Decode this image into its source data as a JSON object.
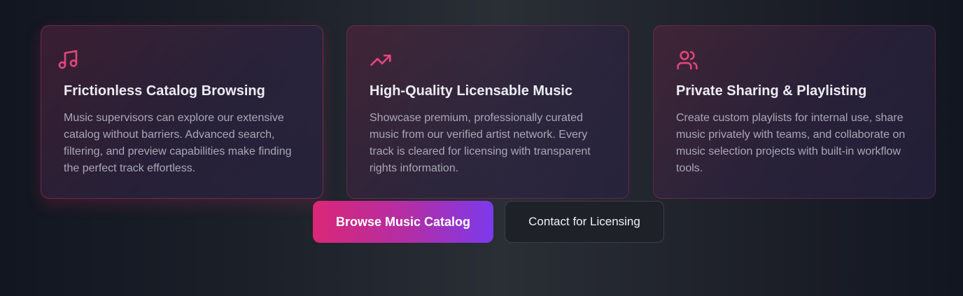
{
  "features": [
    {
      "icon": "music-note-icon",
      "title": "Frictionless Catalog Browsing",
      "description": "Music supervisors can explore our extensive catalog without barriers. Advanced search, filtering, and preview capabilities make finding the perfect track effortless."
    },
    {
      "icon": "trending-up-icon",
      "title": "High-Quality Licensable Music",
      "description": "Showcase premium, professionally curated music from our verified artist network. Every track is cleared for licensing with transparent rights information."
    },
    {
      "icon": "users-icon",
      "title": "Private Sharing & Playlisting",
      "description": "Create custom playlists for internal use, share music privately with teams, and collaborate on music selection projects with built-in workflow tools."
    }
  ],
  "actions": {
    "primary_label": "Browse Music Catalog",
    "secondary_label": "Contact for Licensing"
  },
  "colors": {
    "accent": "#e0457b",
    "button_gradient_start": "#db2777",
    "button_gradient_end": "#7c3aed"
  }
}
